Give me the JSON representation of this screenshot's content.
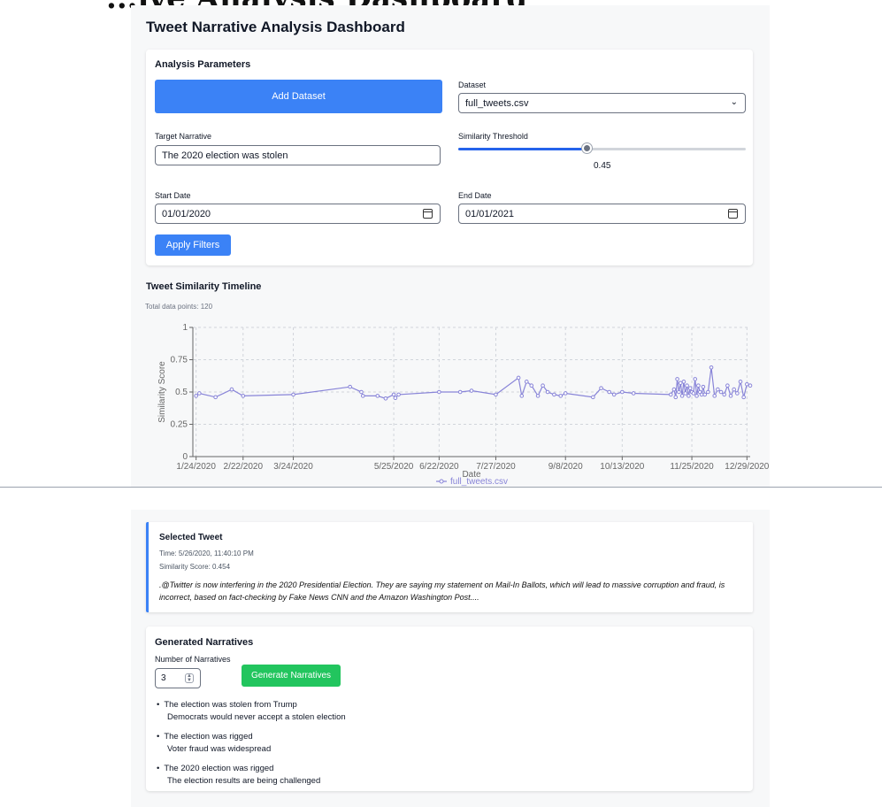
{
  "page": {
    "cutoff_heading": "...ive Analysis Dashboard",
    "title": "Tweet Narrative Analysis Dashboard"
  },
  "params": {
    "title": "Analysis Parameters",
    "add_dataset_label": "Add Dataset",
    "dataset_label": "Dataset",
    "dataset_value": "full_tweets.csv",
    "target_label": "Target Narrative",
    "target_value": "The 2020 election was stolen",
    "threshold_label": "Similarity Threshold",
    "threshold_value": "0.45",
    "threshold_fraction": 0.45,
    "start_label": "Start Date",
    "start_value": "01/01/2020",
    "end_label": "End Date",
    "end_value": "01/01/2021",
    "apply_label": "Apply Filters"
  },
  "timeline": {
    "title": "Tweet Similarity Timeline",
    "total_points": "Total data points: 120"
  },
  "chart_data": {
    "type": "line",
    "xlabel": "Date",
    "ylabel": "Similarity Score",
    "ylim": [
      0,
      1
    ],
    "yticks": [
      "0",
      "0.25",
      "0.5",
      "0.75",
      "1"
    ],
    "xticks": [
      "1/24/2020",
      "2/22/2020",
      "3/24/2020",
      "5/25/2020",
      "6/22/2020",
      "7/27/2020",
      "9/8/2020",
      "10/13/2020",
      "11/25/2020",
      "12/29/2020"
    ],
    "grid": true,
    "legend": "bottom",
    "series": [
      {
        "name": "full_tweets.csv",
        "color": "#8884d8",
        "x": [
          "2020-01-24",
          "2020-01-26",
          "2020-02-05",
          "2020-02-15",
          "2020-02-22",
          "2020-03-24",
          "2020-04-28",
          "2020-05-05",
          "2020-05-06",
          "2020-05-15",
          "2020-05-20",
          "2020-05-25",
          "2020-05-26",
          "2020-05-28",
          "2020-06-22",
          "2020-07-05",
          "2020-07-12",
          "2020-07-27",
          "2020-08-10",
          "2020-08-12",
          "2020-08-15",
          "2020-08-18",
          "2020-08-22",
          "2020-08-25",
          "2020-08-28",
          "2020-09-01",
          "2020-09-05",
          "2020-09-08",
          "2020-09-25",
          "2020-09-30",
          "2020-10-05",
          "2020-10-08",
          "2020-10-13",
          "2020-10-20",
          "2020-11-12",
          "2020-11-14",
          "2020-11-15",
          "2020-11-16",
          "2020-11-17",
          "2020-11-18",
          "2020-11-19",
          "2020-11-20",
          "2020-11-21",
          "2020-11-22",
          "2020-11-23",
          "2020-11-24",
          "2020-11-25",
          "2020-11-26",
          "2020-11-27",
          "2020-11-28",
          "2020-11-29",
          "2020-11-30",
          "2020-12-01",
          "2020-12-02",
          "2020-12-03",
          "2020-12-05",
          "2020-12-07",
          "2020-12-09",
          "2020-12-11",
          "2020-12-13",
          "2020-12-15",
          "2020-12-17",
          "2020-12-19",
          "2020-12-21",
          "2020-12-23",
          "2020-12-25",
          "2020-12-27",
          "2020-12-29",
          "2020-12-31"
        ],
        "y": [
          0.47,
          0.49,
          0.46,
          0.52,
          0.47,
          0.48,
          0.54,
          0.5,
          0.47,
          0.47,
          0.45,
          0.48,
          0.454,
          0.48,
          0.5,
          0.5,
          0.51,
          0.48,
          0.61,
          0.47,
          0.58,
          0.55,
          0.47,
          0.55,
          0.5,
          0.48,
          0.47,
          0.49,
          0.46,
          0.53,
          0.5,
          0.48,
          0.5,
          0.49,
          0.48,
          0.52,
          0.46,
          0.6,
          0.5,
          0.57,
          0.47,
          0.58,
          0.49,
          0.55,
          0.47,
          0.53,
          0.5,
          0.49,
          0.6,
          0.47,
          0.55,
          0.5,
          0.48,
          0.54,
          0.48,
          0.5,
          0.69,
          0.47,
          0.52,
          0.5,
          0.48,
          0.55,
          0.47,
          0.52,
          0.49,
          0.58,
          0.46,
          0.56,
          0.55
        ]
      }
    ]
  },
  "selected": {
    "title": "Selected Tweet",
    "time": "Time: 5/26/2020, 11:40:10 PM",
    "score": "Similarity Score: 0.454",
    "text": ".@Twitter is now interfering in the 2020 Presidential Election. They are saying my statement on Mail-In Ballots, which will lead to massive corruption and fraud, is incorrect, based on fact-checking by Fake News CNN and the Amazon Washington Post...."
  },
  "narratives": {
    "title": "Generated Narratives",
    "count_label": "Number of Narratives",
    "count_value": "3",
    "generate_label": "Generate Narratives",
    "items": [
      {
        "line1": "The election was stolen from Trump",
        "line2": "Democrats would never accept a stolen election"
      },
      {
        "line1": "The election was rigged",
        "line2": "Voter fraud was widespread"
      },
      {
        "line1": "The 2020 election was rigged",
        "line2": "The election results are being challenged"
      }
    ]
  },
  "colors": {
    "primary": "#3b82f6",
    "success": "#22c55e",
    "series": "#8884d8"
  }
}
